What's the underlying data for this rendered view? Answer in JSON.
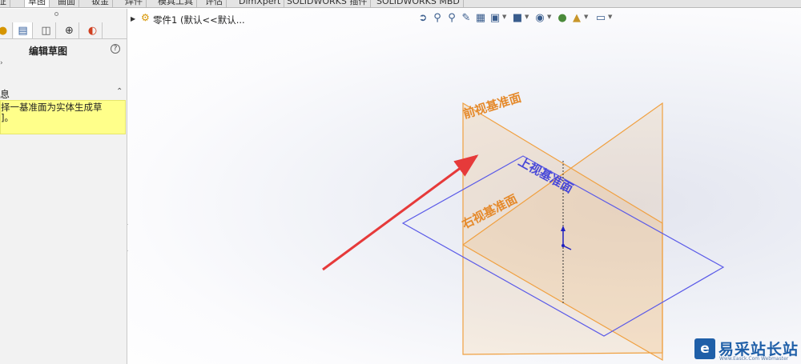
{
  "tabs": [
    {
      "label": "特征",
      "active": false
    },
    {
      "label": "草图",
      "active": true
    },
    {
      "label": "曲面",
      "active": false
    },
    {
      "label": "钣金",
      "active": false
    },
    {
      "label": "焊件",
      "active": false
    },
    {
      "label": "模具工具",
      "active": false
    },
    {
      "label": "评估",
      "active": false
    },
    {
      "label": "DimXpert",
      "active": false
    },
    {
      "label": "SOLIDWORKS 插件",
      "active": false
    },
    {
      "label": "SOLIDWORKS MBD",
      "active": false
    }
  ],
  "panel": {
    "tabs": [
      "feature-manager",
      "property-manager",
      "configuration-manager",
      "dimxpert-manager",
      "display-manager"
    ],
    "title": "编辑草图",
    "help": "?",
    "message_heading": "息",
    "message_lines": [
      "择一基准面为实体生成草",
      "]。"
    ]
  },
  "tree": {
    "part_label": "零件1 (默认<<默认..."
  },
  "hud_icons": [
    "view-orientation-icon",
    "zoom-to-fit-icon",
    "zoom-area-icon",
    "previous-view-icon",
    "section-view-icon",
    "dynamic-annotation-icon",
    "view-orientation-cube-icon",
    "display-style-icon",
    "hide-show-icon",
    "edit-appearance-icon",
    "apply-scene-icon",
    "view-settings-icon"
  ],
  "planes": {
    "front": "前视基准面",
    "top": "上视基准面",
    "right": "右视基准面"
  },
  "colors": {
    "plane_orange": "#f0a040",
    "plane_blue": "#5a5ae8",
    "arrow_red": "#e63a3a",
    "message_yellow": "#ffff8a"
  },
  "watermark": {
    "logo": "e",
    "name": "易采站长站",
    "sub": "Www.Easck.Com Webmaster"
  }
}
